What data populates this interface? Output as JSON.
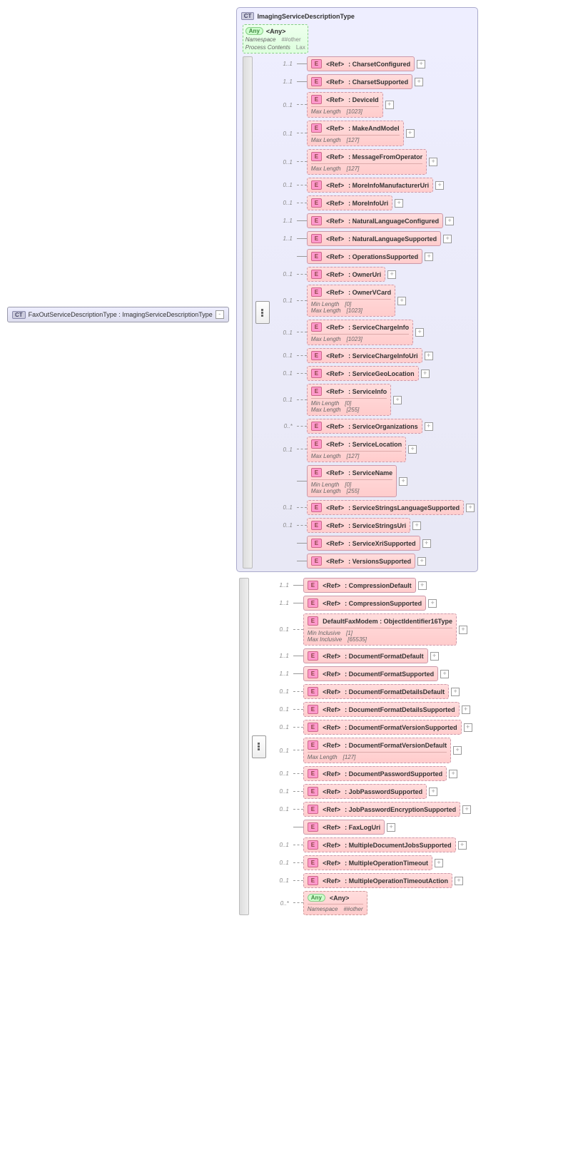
{
  "root": {
    "badge": "CT",
    "label": "FaxOutServiceDescriptionType : ImagingServiceDescriptionType"
  },
  "ctBox": {
    "badge": "CT",
    "label": "ImagingServiceDescriptionType"
  },
  "anyBox": {
    "badge": "Any",
    "label": "<Any>",
    "ns": {
      "k": "Namespace",
      "v": "##other"
    },
    "pc": {
      "k": "Process Contents",
      "v": "Lax"
    }
  },
  "refLabel": "<Ref>",
  "anyLabel": "<Any>",
  "eBadge": "E",
  "innerItems": [
    {
      "occ": "1..1",
      "name": ": CharsetConfigured"
    },
    {
      "occ": "1..1",
      "name": ": CharsetSupported"
    },
    {
      "occ": "0..1",
      "name": ": DeviceId",
      "opt": true,
      "sub": [
        {
          "k": "Max Length",
          "v": "[1023]"
        }
      ]
    },
    {
      "occ": "0..1",
      "name": ": MakeAndModel",
      "opt": true,
      "sub": [
        {
          "k": "Max Length",
          "v": "[127]"
        }
      ]
    },
    {
      "occ": "0..1",
      "name": ": MessageFromOperator",
      "opt": true,
      "sub": [
        {
          "k": "Max Length",
          "v": "[127]"
        }
      ]
    },
    {
      "occ": "0..1",
      "name": ": MoreInfoManufacturerUri",
      "opt": true
    },
    {
      "occ": "0..1",
      "name": ": MoreInfoUri",
      "opt": true
    },
    {
      "occ": "1..1",
      "name": ": NaturalLanguageConfigured"
    },
    {
      "occ": "1..1",
      "name": ": NaturalLanguageSupported"
    },
    {
      "occ": "",
      "name": ": OperationsSupported"
    },
    {
      "occ": "0..1",
      "name": ": OwnerUri",
      "opt": true
    },
    {
      "occ": "0..1",
      "name": ": OwnerVCard",
      "opt": true,
      "sub": [
        {
          "k": "Min Length",
          "v": "[0]"
        },
        {
          "k": "Max Length",
          "v": "[1023]"
        }
      ]
    },
    {
      "occ": "0..1",
      "name": ": ServiceChargeInfo",
      "opt": true,
      "sub": [
        {
          "k": "Max Length",
          "v": "[1023]"
        }
      ]
    },
    {
      "occ": "0..1",
      "name": ": ServiceChargeInfoUri",
      "opt": true
    },
    {
      "occ": "0..1",
      "name": ": ServiceGeoLocation",
      "opt": true
    },
    {
      "occ": "0..1",
      "name": ": ServiceInfo",
      "opt": true,
      "sub": [
        {
          "k": "Min Length",
          "v": "[0]"
        },
        {
          "k": "Max Length",
          "v": "[255]"
        }
      ]
    },
    {
      "occ": "0..*",
      "name": ": ServiceOrganizations",
      "opt": true
    },
    {
      "occ": "0..1",
      "name": ": ServiceLocation",
      "opt": true,
      "sub": [
        {
          "k": "Max Length",
          "v": "[127]"
        }
      ]
    },
    {
      "occ": "",
      "name": ": ServiceName",
      "sub": [
        {
          "k": "Min Length",
          "v": "[0]"
        },
        {
          "k": "Max Length",
          "v": "[255]"
        }
      ]
    },
    {
      "occ": "0..1",
      "name": ": ServiceStringsLanguageSupported",
      "opt": true
    },
    {
      "occ": "0..1",
      "name": ": ServiceStringsUri",
      "opt": true
    },
    {
      "occ": "",
      "name": ": ServiceXriSupported"
    },
    {
      "occ": "",
      "name": ": VersionsSupported"
    }
  ],
  "outerItems": [
    {
      "occ": "1..1",
      "name": ": CompressionDefault"
    },
    {
      "occ": "1..1",
      "name": ": CompressionSupported"
    },
    {
      "occ": "0..1",
      "opt": true,
      "custom": "DefaultFaxModem : ObjectIdentifier16Type",
      "sub": [
        {
          "k": "Min Inclusive",
          "v": "[1]"
        },
        {
          "k": "Max Inclusive",
          "v": "[65535]"
        }
      ]
    },
    {
      "occ": "1..1",
      "name": ": DocumentFormatDefault"
    },
    {
      "occ": "1..1",
      "name": ": DocumentFormatSupported"
    },
    {
      "occ": "0..1",
      "name": ": DocumentFormatDetailsDefault",
      "opt": true
    },
    {
      "occ": "0..1",
      "name": ": DocumentFormatDetailsSupported",
      "opt": true
    },
    {
      "occ": "0..1",
      "name": ": DocumentFormatVersionSupported",
      "opt": true
    },
    {
      "occ": "0..1",
      "name": ": DocumentFormatVersionDefault",
      "opt": true,
      "sub": [
        {
          "k": "Max Length",
          "v": "[127]"
        }
      ]
    },
    {
      "occ": "0..1",
      "name": ": DocumentPasswordSupported",
      "opt": true
    },
    {
      "occ": "0..1",
      "name": ": JobPasswordSupported",
      "opt": true
    },
    {
      "occ": "0..1",
      "name": ": JobPasswordEncryptionSupported",
      "opt": true
    },
    {
      "occ": "",
      "name": ": FaxLogUri"
    },
    {
      "occ": "0..1",
      "name": ": MultipleDocumentJobsSupported",
      "opt": true
    },
    {
      "occ": "0..1",
      "name": ": MultipleOperationTimeout",
      "opt": true
    },
    {
      "occ": "0..1",
      "name": ": MultipleOperationTimeoutAction",
      "opt": true
    }
  ],
  "outerAny": {
    "occ": "0..*",
    "label": "<Any>",
    "sub": [
      {
        "k": "Namespace",
        "v": "##other"
      }
    ]
  }
}
